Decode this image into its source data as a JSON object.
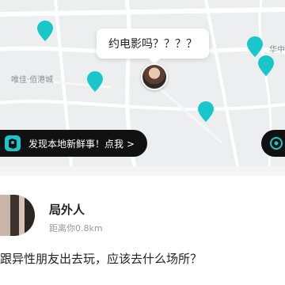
{
  "map": {
    "places": [
      {
        "id": "weijia",
        "label": "唯佳·佰港城"
      },
      {
        "id": "huazhong",
        "label": "华中"
      }
    ],
    "bubble_text": "约电影吗？？？？",
    "pin_color": "#19c6c9"
  },
  "discover": {
    "label": "发现本地新鲜事！点我 >"
  },
  "post": {
    "author": "局外人",
    "distance": "距离你0.8km",
    "content": "跟异性朋友出去玩，应该去什么场所？"
  }
}
